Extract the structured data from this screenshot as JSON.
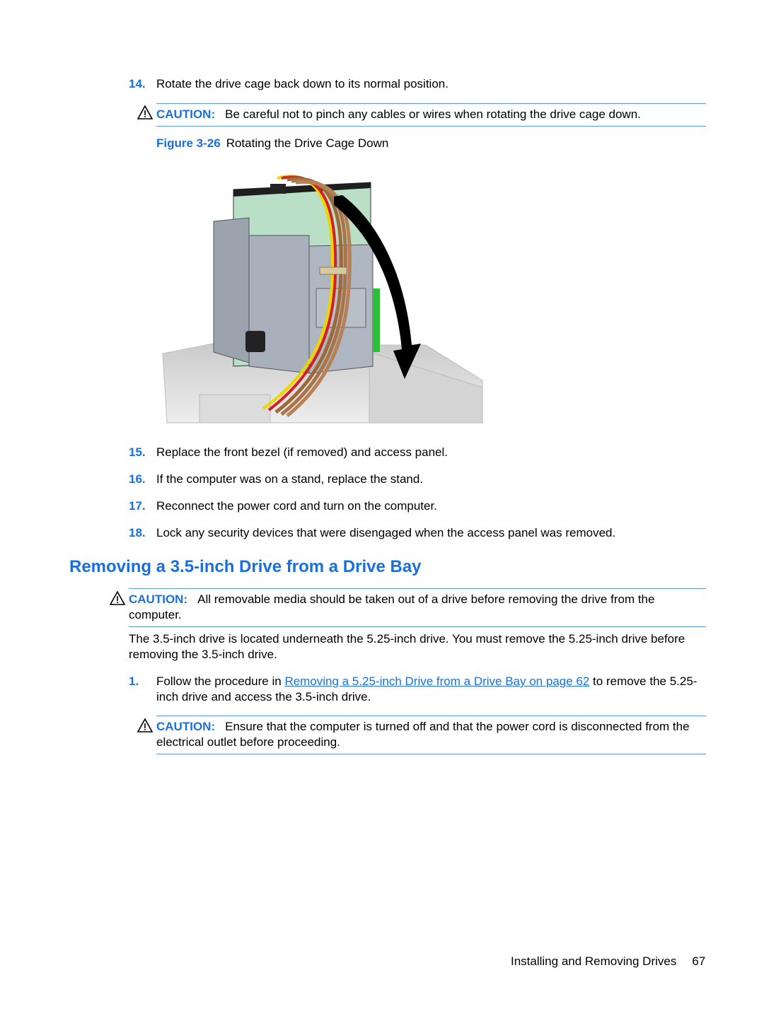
{
  "steps_top": [
    {
      "number": "14.",
      "text": "Rotate the drive cage back down to its normal position."
    }
  ],
  "caution_1": {
    "label": "CAUTION:",
    "text": "Be careful not to pinch any cables or wires when rotating the drive cage down.",
    "icon": "warning-triangle-icon"
  },
  "figure": {
    "label": "Figure 3-26",
    "caption": "Rotating the Drive Cage Down",
    "description": "Illustration of a drive cage with cables being rotated down, indicated by a large black curved arrow"
  },
  "steps_after_figure": [
    {
      "number": "15.",
      "text": "Replace the front bezel (if removed) and access panel."
    },
    {
      "number": "16.",
      "text": "If the computer was on a stand, replace the stand."
    },
    {
      "number": "17.",
      "text": "Reconnect the power cord and turn on the computer."
    },
    {
      "number": "18.",
      "text": "Lock any security devices that were disengaged when the access panel was removed."
    }
  ],
  "section_heading": "Removing a 3.5-inch Drive from a Drive Bay",
  "caution_2": {
    "label": "CAUTION:",
    "text": "All removable media should be taken out of a drive before removing the drive from the computer.",
    "icon": "warning-triangle-icon"
  },
  "intro_paragraph": "The 3.5-inch drive is located underneath the 5.25-inch drive. You must remove the 5.25-inch drive before removing the 3.5-inch drive.",
  "section_steps": [
    {
      "number": "1.",
      "text_before": "Follow the procedure in ",
      "link": "Removing a 5.25-inch Drive from a Drive Bay on page 62",
      "text_after": " to remove the 5.25-inch drive and access the 3.5-inch drive."
    }
  ],
  "caution_3": {
    "label": "CAUTION:",
    "text": "Ensure that the computer is turned off and that the power cord is disconnected from the electrical outlet before proceeding.",
    "icon": "warning-triangle-icon"
  },
  "footer": {
    "section": "Installing and Removing Drives",
    "page_number": "67"
  },
  "colors": {
    "accent": "#1a6fdf",
    "rule": "#5b9ae6"
  }
}
